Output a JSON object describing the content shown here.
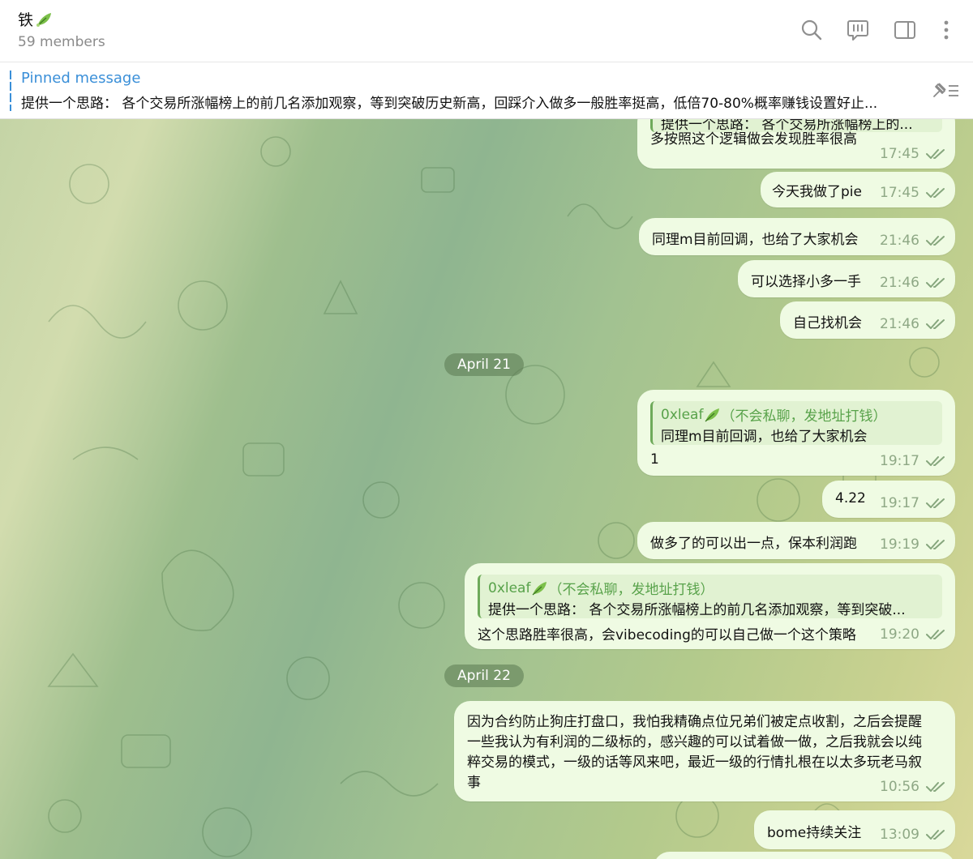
{
  "header": {
    "title": "铁",
    "subtitle": "59 members"
  },
  "pinned": {
    "label": "Pinned message",
    "text": "提供一个思路： 各个交易所涨幅榜上的前几名添加观察，等到突破历史新高，回踩介入做多一般胜率挺高，低倍70-80%概率赚钱设置好止..."
  },
  "messages": [
    {
      "id": "m1",
      "reply_text": "提供一个思路： 各个交易所涨幅榜上的...",
      "text": "多按照这个逻辑做会发现胜率很高",
      "time": "17:45"
    },
    {
      "id": "m2",
      "text": "今天我做了pie",
      "time": "17:45"
    },
    {
      "id": "m3",
      "text": "同理m目前回调，也给了大家机会",
      "time": "21:46"
    },
    {
      "id": "m4",
      "text": "可以选择小多一手",
      "time": "21:46"
    },
    {
      "id": "m5",
      "text": "自己找机会",
      "time": "21:46"
    },
    {
      "id": "m6",
      "reply_name": "0xleaf",
      "reply_suffix": "（不会私聊，发地址打钱）",
      "reply_text": "同理m目前回调，也给了大家机会",
      "text": "1",
      "time": "19:17"
    },
    {
      "id": "m7",
      "text": "4.22",
      "time": "19:17"
    },
    {
      "id": "m8",
      "text": "做多了的可以出一点，保本利润跑",
      "time": "19:19"
    },
    {
      "id": "m9",
      "reply_name": "0xleaf",
      "reply_suffix": "（不会私聊，发地址打钱）",
      "reply_text": "提供一个思路： 各个交易所涨幅榜上的前几名添加观察，等到突破...",
      "text": "这个思路胜率很高，会vibecoding的可以自己做一个这个策略",
      "time": "19:20"
    },
    {
      "id": "m10",
      "lines": [
        "因为合约防止狗庄打盘口，我怕我精确点位兄弟们被定点收割，之后会提醒",
        "一些我认为有利润的二级标的，感兴趣的可以试着做一做，之后我就会以纯",
        "粹交易的模式，一级的话等风来吧，最近一级的行情扎根在以太多玩老马叙",
        "事"
      ],
      "time": "10:56"
    },
    {
      "id": "m11",
      "text": "bome持续关注",
      "time": "13:09"
    }
  ],
  "dates": {
    "d1": "April 21",
    "d2": "April 22"
  },
  "colors": {
    "bubble": "#effbe3",
    "accent": "#3a8fd8",
    "reply_name": "#58a24a"
  },
  "icons": {
    "search": "search-icon",
    "topics": "topics-icon",
    "sidebar": "sidebar-toggle-icon",
    "more": "more-vertical-icon",
    "pin_list": "pin-list-icon",
    "read": "double-check-icon"
  }
}
